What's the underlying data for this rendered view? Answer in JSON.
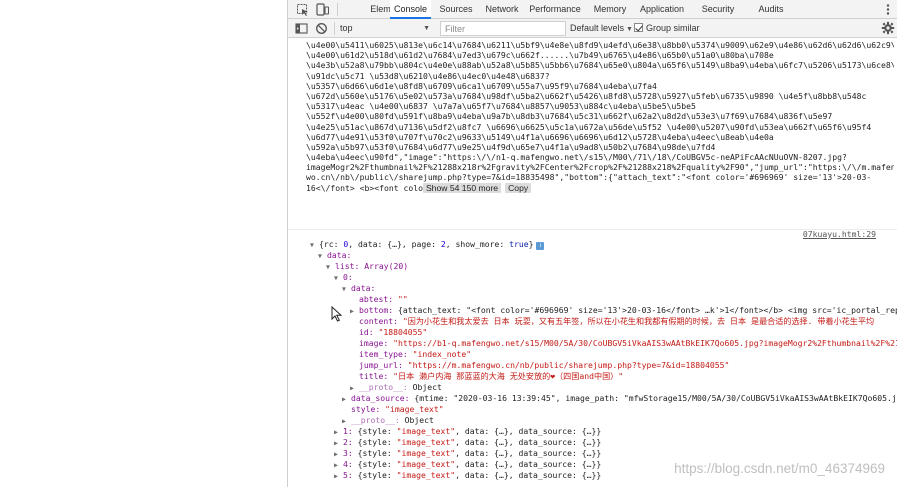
{
  "devtools": {
    "tabs": [
      "Elements",
      "Console",
      "Sources",
      "Network",
      "Performance",
      "Memory",
      "Application",
      "Security",
      "Audits"
    ],
    "active_tab": "Console",
    "icons": {
      "inspect": "cursor-select-icon",
      "device": "device-toolbar-icon",
      "more": "kebab-menu-icon",
      "sidebar": "sidebar-toggle-icon",
      "clear": "block-icon",
      "settings": "gear-icon"
    }
  },
  "toolbar": {
    "context": "top",
    "filter_placeholder": "Filter",
    "levels": "Default levels",
    "group_similar": "Group similar",
    "group_similar_checked": true
  },
  "message": {
    "lines": [
      "\\u4e00\\u5411\\u6025\\u813e\\u6c14\\u7684\\u6211\\u5bf9\\u4e8e\\u8fd9\\u4efd\\u6e38\\u8bb0\\u5374\\u9009\\u62e9\\u4e86\\u62d6\\u62d6\\u62c9\\u62c9 \\u78e8\\u78e8\\u53fd\\u53fd",
      "\\u4e00\\u61d2\\u518d\\u61d2\\u7684\\u7ed3\\u679c\\u662f......\\u7b49\\u6765\\u4e86\\u65b0\\u51a0\\u80ba\\u708e",
      "\\u4e3b\\u52a8\\u79bb\\u804c\\u4e0e\\u88ab\\u52a8\\u5b85\\u5bb6\\u7684\\u65e0\\u804a\\u65f6\\u5149\\u8ba9\\u4eba\\u6fc7\\u5206\\u5173\\u6ce8\\u75ab\\u60c5 \\u6bcf\\u5929\\u770b\\u7740 \\u97e9\\u56fd \\u4e0d\\u65ad\\u5347\\u7684\\u611f\\u67d3\\u4eba\\u6570 \\u518d\\u77a7\\u77a7\\u91dc\\u5c71 \\u6e38\\u73a9\\u65f6\\u7684\\u7167\\u7247 \\u65e0\\u9650\\u611f\\u6168 \\u4e0d\\u77e5\\u9053\\u73b0\\u5728\\u7684",
      "\\u91dc\\u5c71 \\u53d8\\u6210\\u4e86\\u4ec0\\u4e48\\u6837?",
      "\\u5357\\u6d66\\u6d1e\\u8fd8\\u6709\\u6ca1\\u6709\\u55a7\\u95f9\\u7684\\u4eba\\u7fa4",
      "\\u672d\\u560e\\u5176\\u5e02\\u573a\\u7684\\u98df\\u5ba2\\u662f\\u5426\\u8fd8\\u5728\\u5927\\u5feb\\u6735\\u9890 \\u4e5f\\u8bb8\\u548c",
      "\\u5317\\u4eac \\u4e00\\u6837 \\u7a7a\\u65f7\\u7684\\u8857\\u9053\\u884c\\u4eba\\u5be5\\u5be5",
      "\\u552f\\u4e00\\u80fd\\u591f\\u8ba9\\u4eba\\u9a7b\\u8db3\\u7684\\u5c31\\u662f\\u62a2\\u8d2d\\u53e3\\u7f69\\u7684\\u836f\\u5e97",
      "\\u4e25\\u51ac\\u867d\\u7136\\u5df2\\u8fc7 \\u6696\\u6625\\u5c1a\\u672a\\u56de\\u5f52 \\u4e00\\u5207\\u90fd\\u53ea\\u662f\\u65f6\\u95f4",
      "\\u6d77\\u4e91\\u53f0\\u707f\\u70c2\\u9633\\u5149\\u4f1a\\u6696\\u6696\\u6d12\\u5728\\u4eba\\u4eec\\u8eab\\u4e0a",
      "\\u592a\\u5b97\\u53f0\\u7684\\u6d77\\u9e25\\u4f9d\\u65e7\\u4f1a\\u9ad8\\u50b2\\u7684\\u98de\\u7fd4",
      "\\u4eba\\u4eec\\u90fd\",\"image\":\"https:\\/\\/n1-q.mafengwo.net\\/s15\\/M00\\/71\\/18\\/CoUBGV5c-neAPiFcAAcNUuOVN-8207.jpg?",
      "imageMogr2%2Fthumbnail%2F%21288x218r%2Fgravity%2FCenter%2Fcrop%2F%21288x218%2Fquality%2F90\",\"jump_url\":\"https:\\/\\/m.mafeng",
      "wo.cn\\/nb\\/public\\/sharejump.php?type=7&id=18835498\",\"bottom\":{\"attach_text\":\"<font color='#696969' size='13'>20-03-",
      "16<\\/font>  <b><font colo"
    ],
    "show_more_label": "Show 54 150 more",
    "copy_label": "Copy",
    "source_link": "07kuayu.html:29"
  },
  "tree": {
    "root": [
      "{rc: ",
      "0",
      ", data: {…}, page: ",
      "2",
      ", show_more: ",
      "true",
      "}"
    ],
    "data_key": "data:",
    "list_key": "list: Array(20)",
    "item0_key": "0:",
    "inner_data_key": "data:",
    "abtest": {
      "key": "abtest:",
      "value": "\"\""
    },
    "bottom": {
      "key": "bottom:",
      "value": "{attach_text: \"<font color='#696969' size='13'>20-03-16</font>   …k'>1</font></b> <img src='ic_portal_reply"
    },
    "content": {
      "key": "content:",
      "value": "\"因为小花生和我太爱去 日本 玩耍，又有五年签，所以在小花生和我都有假期的时候，去 日本 是最合适的选择. 带着小花生平均"
    },
    "id": {
      "key": "id:",
      "value": "\"18804055\""
    },
    "image": {
      "key": "image:",
      "value": "\"https://b1-q.mafengwo.net/s15/M00/5A/30/CoUBGV5iVkaAIS3wAAtBkEIK7Qo605.jpg?imageMogr2%2Fthumbnail%2F%21288x2"
    },
    "item_type": {
      "key": "item_type:",
      "value": "\"index_note\""
    },
    "jump_url": {
      "key": "jump_url:",
      "value": "\"https://m.mafengwo.cn/nb/public/sharejump.php?type=7&id=18804055\""
    },
    "title": {
      "key": "title:",
      "value": "\"日本 濑户内海 那蓝蓝的大海 无处安放的❤（四国and中国）\""
    },
    "proto_inner": {
      "key": "__proto__:",
      "value": "Object"
    },
    "data_source": {
      "key": "data_source:",
      "value": "{mtime: \"2020-03-16 13:39:45\", image_path: \"mfwStorage15/M00/5A/30/CoUBGV5iVkaAIS3wAAtBkEIK7Qo605.jpg\", "
    },
    "style": {
      "key": "style:",
      "value": "\"image_text\""
    },
    "proto_item": {
      "key": "__proto__:",
      "value": "Object"
    },
    "collapsed_items": [
      {
        "idx": "1:",
        "value": " {style: \"image_text\", data: {…}, data_source: {…}}"
      },
      {
        "idx": "2:",
        "value": " {style: \"image_text\", data: {…}, data_source: {…}}"
      },
      {
        "idx": "3:",
        "value": " {style: \"image_text\", data: {…}, data_source: {…}}"
      },
      {
        "idx": "4:",
        "value": " {style: \"image_text\", data: {…}, data_source: {…}}"
      },
      {
        "idx": "5:",
        "value": " {style: \"image_text\", data: {…}, data_source: {…}}"
      }
    ]
  },
  "watermark": "https://blog.csdn.net/m0_46374969"
}
